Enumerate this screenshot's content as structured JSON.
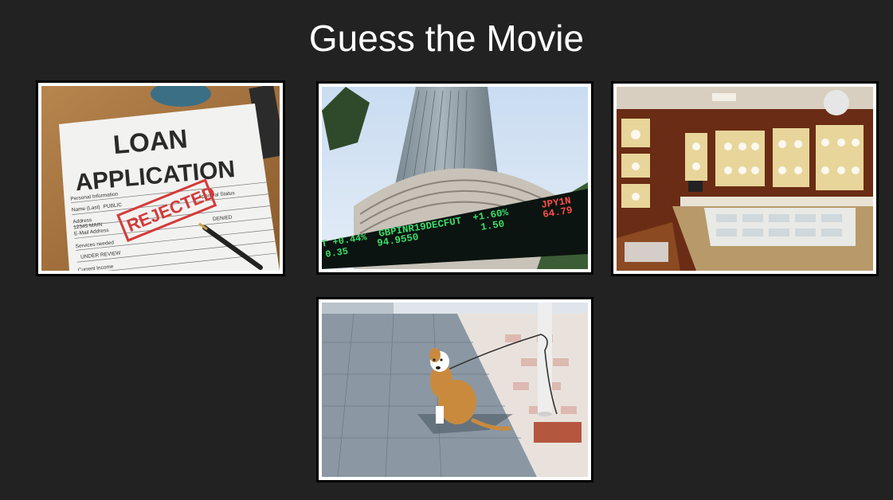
{
  "slide": {
    "title": "Guess the Movie"
  },
  "clues": {
    "loan": {
      "heading_line1": "LOAN",
      "heading_line2": "APPLICATION",
      "stamp": "REJECTED",
      "form_labels": [
        "Personal Information",
        "Name (Last)",
        "PUBLIC",
        "Address",
        "12345 MAIN",
        "E-Mail Address",
        "Services needed",
        "UNDER REVIEW",
        "Current Income",
        "Approval Status",
        "DENIED"
      ]
    },
    "stock": {
      "ticker_1": "GBPINR19DECFUT",
      "ticker_1_change": "+1.60%",
      "ticker_1_price": "94.9550",
      "ticker_1_sub": "1.50",
      "ticker_2_change": "T +0.44%",
      "ticker_2_sub": "0.35",
      "ticker_3": "JPY1N",
      "ticker_3_price": "64.79"
    },
    "jewelry": {},
    "dog": {}
  },
  "colors": {
    "background": "#222222",
    "title": "#ffffff",
    "ticker_green": "#3ddc6a",
    "ticker_red": "#ff4d4d",
    "stamp_red": "#d43a3a"
  }
}
